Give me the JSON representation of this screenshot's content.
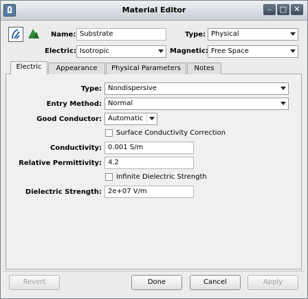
{
  "window": {
    "title": "Material Editor",
    "controls": {
      "minimize": "–",
      "maximize": "□",
      "close": "✕"
    }
  },
  "toolbar": {
    "icons": [
      "material-definition-icon",
      "material-library-icon"
    ]
  },
  "header": {
    "name_label": "Name:",
    "name_value": "Substrate",
    "type_label": "Type:",
    "type_value": "Physical",
    "electric_label": "Electric:",
    "electric_value": "Isotropic",
    "magnetic_label": "Magnetic:",
    "magnetic_value": "Free Space"
  },
  "tabs": [
    {
      "label": "Electric",
      "active": true
    },
    {
      "label": "Appearance",
      "active": false
    },
    {
      "label": "Physical Parameters",
      "active": false
    },
    {
      "label": "Notes",
      "active": false
    }
  ],
  "electric": {
    "type_label": "Type:",
    "type_value": "Nondispersive",
    "entry_method_label": "Entry Method:",
    "entry_method_value": "Normal",
    "good_conductor_label": "Good Conductor:",
    "good_conductor_value": "Automatic",
    "surface_conductivity_label": "Surface Conductivity Correction",
    "surface_conductivity_checked": false,
    "conductivity_label": "Conductivity:",
    "conductivity_value": "0.001 S/m",
    "permittivity_label": "Relative Permittivity:",
    "permittivity_value": "4.2",
    "infinite_strength_label": "Infinite Dielectric Strength",
    "infinite_strength_checked": false,
    "dielectric_strength_label": "Dielectric Strength:",
    "dielectric_strength_value": "2e+07 V/m"
  },
  "buttons": {
    "revert": "Revert",
    "done": "Done",
    "cancel": "Cancel",
    "apply": "Apply"
  },
  "colors": {
    "accent_green": "#2e8b3a",
    "icon_blue": "#2f5fa8"
  }
}
